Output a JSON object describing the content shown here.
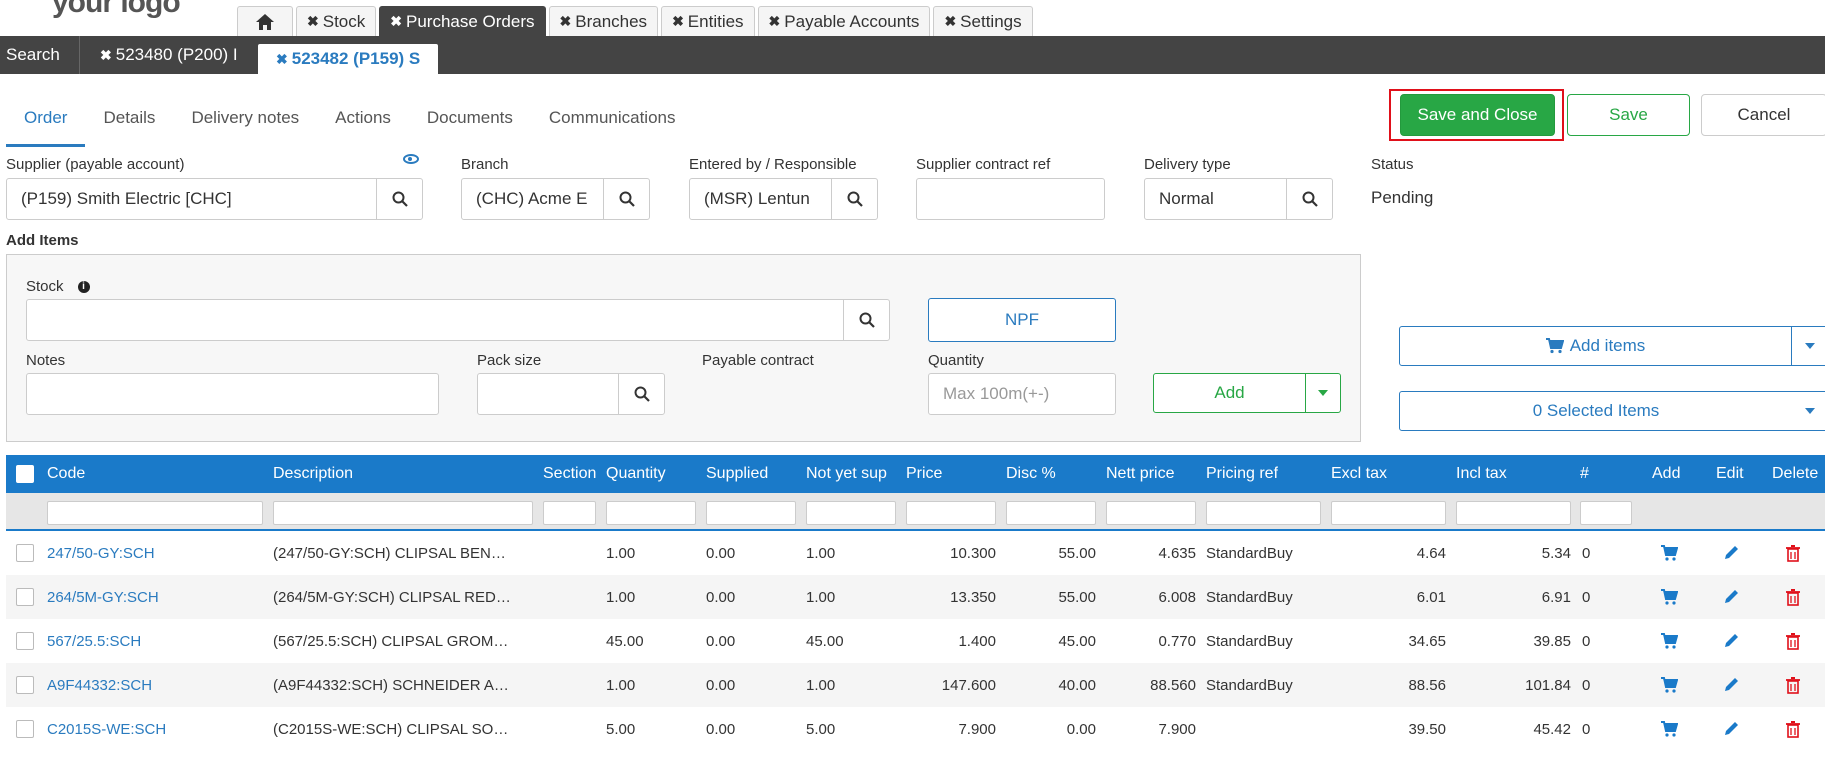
{
  "logo": "your logo",
  "top_tabs": [
    {
      "label": "Stock"
    },
    {
      "label": "Purchase Orders"
    },
    {
      "label": "Branches"
    },
    {
      "label": "Entities"
    },
    {
      "label": "Payable Accounts"
    },
    {
      "label": "Settings"
    }
  ],
  "subbar": {
    "search": "Search",
    "record1": "523480 (P200) I",
    "record2": "523482 (P159) S"
  },
  "page_tabs": [
    "Order",
    "Details",
    "Delivery notes",
    "Actions",
    "Documents",
    "Communications"
  ],
  "buttons": {
    "save_close": "Save and Close",
    "save": "Save",
    "cancel": "Cancel",
    "npf": "NPF",
    "add": "Add",
    "add_items": "Add items",
    "selected_items": "0 Selected Items"
  },
  "form": {
    "supplier_label": "Supplier (payable account)",
    "supplier_value": "(P159) Smith Electric [CHC]",
    "branch_label": "Branch",
    "branch_value": "(CHC) Acme E",
    "entered_label": "Entered by / Responsible",
    "entered_value": "(MSR) Lentun",
    "contract_label": "Supplier contract ref",
    "contract_value": "",
    "delivery_label": "Delivery type",
    "delivery_value": "Normal",
    "status_label": "Status",
    "status_value": "Pending"
  },
  "add_items": {
    "title": "Add Items",
    "stock_label": "Stock",
    "notes_label": "Notes",
    "pack_label": "Pack size",
    "payable_contract_label": "Payable contract",
    "quantity_label": "Quantity",
    "quantity_placeholder": "Max 100m(+-)"
  },
  "table": {
    "columns": [
      "Code",
      "Description",
      "Section",
      "Quantity",
      "Supplied",
      "Not yet sup",
      "Price",
      "Disc %",
      "Nett price",
      "Pricing ref",
      "Excl tax",
      "Incl tax",
      "#",
      "Add",
      "Edit",
      "Delete"
    ],
    "rows": [
      {
        "code": "247/50-GY:SCH",
        "desc": "(247/50-GY:SCH) CLIPSAL BEN…",
        "section": "",
        "qty": "1.00",
        "supplied": "0.00",
        "nys": "1.00",
        "price": "10.300",
        "disc": "55.00",
        "nett": "4.635",
        "ref": "StandardBuy",
        "excl": "4.64",
        "incl": "5.34",
        "num": "0"
      },
      {
        "code": "264/5M-GY:SCH",
        "desc": "(264/5M-GY:SCH) CLIPSAL RED…",
        "section": "",
        "qty": "1.00",
        "supplied": "0.00",
        "nys": "1.00",
        "price": "13.350",
        "disc": "55.00",
        "nett": "6.008",
        "ref": "StandardBuy",
        "excl": "6.01",
        "incl": "6.91",
        "num": "0"
      },
      {
        "code": "567/25.5:SCH",
        "desc": "(567/25.5:SCH) CLIPSAL GROM…",
        "section": "",
        "qty": "45.00",
        "supplied": "0.00",
        "nys": "45.00",
        "price": "1.400",
        "disc": "45.00",
        "nett": "0.770",
        "ref": "StandardBuy",
        "excl": "34.65",
        "incl": "39.85",
        "num": "0"
      },
      {
        "code": "A9F44332:SCH",
        "desc": "(A9F44332:SCH) SCHNEIDER A…",
        "section": "",
        "qty": "1.00",
        "supplied": "0.00",
        "nys": "1.00",
        "price": "147.600",
        "disc": "40.00",
        "nett": "88.560",
        "ref": "StandardBuy",
        "excl": "88.56",
        "incl": "101.84",
        "num": "0"
      },
      {
        "code": "C2015S-WE:SCH",
        "desc": "(C2015S-WE:SCH) CLIPSAL SO…",
        "section": "",
        "qty": "5.00",
        "supplied": "0.00",
        "nys": "5.00",
        "price": "7.900",
        "disc": "0.00",
        "nett": "7.900",
        "ref": "",
        "excl": "39.50",
        "incl": "45.42",
        "num": "0"
      }
    ]
  },
  "colors": {
    "primary": "#1a7ac9",
    "success": "#28a745",
    "danger": "#e0101a",
    "dark_bar": "#444444"
  }
}
